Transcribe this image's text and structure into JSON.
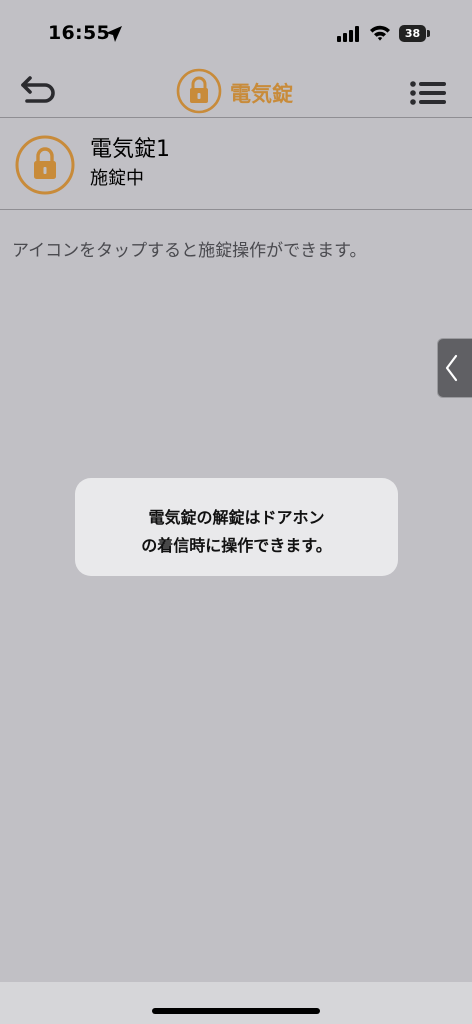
{
  "status_bar": {
    "time": "16:55",
    "battery": "38"
  },
  "nav": {
    "title": "電気錠",
    "accent_color": "#c88b3a",
    "back_icon": "return-arrow-icon",
    "menu_icon": "list-menu-icon"
  },
  "device": {
    "name": "電気錠1",
    "status": "施錠中",
    "icon": "padlock-icon"
  },
  "hint": "アイコンをタップすると施錠操作ができます。",
  "toast": {
    "line1": "電気錠の解錠はドアホン",
    "line2": "の着信時に操作できます。"
  }
}
